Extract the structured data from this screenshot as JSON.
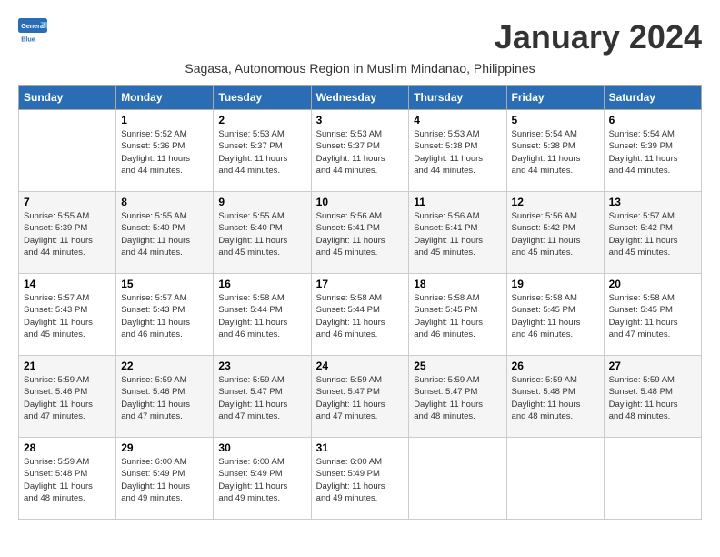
{
  "header": {
    "logo_general": "General",
    "logo_blue": "Blue",
    "month_title": "January 2024",
    "subtitle": "Sagasa, Autonomous Region in Muslim Mindanao, Philippines"
  },
  "days_of_week": [
    "Sunday",
    "Monday",
    "Tuesday",
    "Wednesday",
    "Thursday",
    "Friday",
    "Saturday"
  ],
  "weeks": [
    [
      {
        "day": "",
        "info": ""
      },
      {
        "day": "1",
        "info": "Sunrise: 5:52 AM\nSunset: 5:36 PM\nDaylight: 11 hours\nand 44 minutes."
      },
      {
        "day": "2",
        "info": "Sunrise: 5:53 AM\nSunset: 5:37 PM\nDaylight: 11 hours\nand 44 minutes."
      },
      {
        "day": "3",
        "info": "Sunrise: 5:53 AM\nSunset: 5:37 PM\nDaylight: 11 hours\nand 44 minutes."
      },
      {
        "day": "4",
        "info": "Sunrise: 5:53 AM\nSunset: 5:38 PM\nDaylight: 11 hours\nand 44 minutes."
      },
      {
        "day": "5",
        "info": "Sunrise: 5:54 AM\nSunset: 5:38 PM\nDaylight: 11 hours\nand 44 minutes."
      },
      {
        "day": "6",
        "info": "Sunrise: 5:54 AM\nSunset: 5:39 PM\nDaylight: 11 hours\nand 44 minutes."
      }
    ],
    [
      {
        "day": "7",
        "info": "Sunrise: 5:55 AM\nSunset: 5:39 PM\nDaylight: 11 hours\nand 44 minutes."
      },
      {
        "day": "8",
        "info": "Sunrise: 5:55 AM\nSunset: 5:40 PM\nDaylight: 11 hours\nand 44 minutes."
      },
      {
        "day": "9",
        "info": "Sunrise: 5:55 AM\nSunset: 5:40 PM\nDaylight: 11 hours\nand 45 minutes."
      },
      {
        "day": "10",
        "info": "Sunrise: 5:56 AM\nSunset: 5:41 PM\nDaylight: 11 hours\nand 45 minutes."
      },
      {
        "day": "11",
        "info": "Sunrise: 5:56 AM\nSunset: 5:41 PM\nDaylight: 11 hours\nand 45 minutes."
      },
      {
        "day": "12",
        "info": "Sunrise: 5:56 AM\nSunset: 5:42 PM\nDaylight: 11 hours\nand 45 minutes."
      },
      {
        "day": "13",
        "info": "Sunrise: 5:57 AM\nSunset: 5:42 PM\nDaylight: 11 hours\nand 45 minutes."
      }
    ],
    [
      {
        "day": "14",
        "info": "Sunrise: 5:57 AM\nSunset: 5:43 PM\nDaylight: 11 hours\nand 45 minutes."
      },
      {
        "day": "15",
        "info": "Sunrise: 5:57 AM\nSunset: 5:43 PM\nDaylight: 11 hours\nand 46 minutes."
      },
      {
        "day": "16",
        "info": "Sunrise: 5:58 AM\nSunset: 5:44 PM\nDaylight: 11 hours\nand 46 minutes."
      },
      {
        "day": "17",
        "info": "Sunrise: 5:58 AM\nSunset: 5:44 PM\nDaylight: 11 hours\nand 46 minutes."
      },
      {
        "day": "18",
        "info": "Sunrise: 5:58 AM\nSunset: 5:45 PM\nDaylight: 11 hours\nand 46 minutes."
      },
      {
        "day": "19",
        "info": "Sunrise: 5:58 AM\nSunset: 5:45 PM\nDaylight: 11 hours\nand 46 minutes."
      },
      {
        "day": "20",
        "info": "Sunrise: 5:58 AM\nSunset: 5:45 PM\nDaylight: 11 hours\nand 47 minutes."
      }
    ],
    [
      {
        "day": "21",
        "info": "Sunrise: 5:59 AM\nSunset: 5:46 PM\nDaylight: 11 hours\nand 47 minutes."
      },
      {
        "day": "22",
        "info": "Sunrise: 5:59 AM\nSunset: 5:46 PM\nDaylight: 11 hours\nand 47 minutes."
      },
      {
        "day": "23",
        "info": "Sunrise: 5:59 AM\nSunset: 5:47 PM\nDaylight: 11 hours\nand 47 minutes."
      },
      {
        "day": "24",
        "info": "Sunrise: 5:59 AM\nSunset: 5:47 PM\nDaylight: 11 hours\nand 47 minutes."
      },
      {
        "day": "25",
        "info": "Sunrise: 5:59 AM\nSunset: 5:47 PM\nDaylight: 11 hours\nand 48 minutes."
      },
      {
        "day": "26",
        "info": "Sunrise: 5:59 AM\nSunset: 5:48 PM\nDaylight: 11 hours\nand 48 minutes."
      },
      {
        "day": "27",
        "info": "Sunrise: 5:59 AM\nSunset: 5:48 PM\nDaylight: 11 hours\nand 48 minutes."
      }
    ],
    [
      {
        "day": "28",
        "info": "Sunrise: 5:59 AM\nSunset: 5:48 PM\nDaylight: 11 hours\nand 48 minutes."
      },
      {
        "day": "29",
        "info": "Sunrise: 6:00 AM\nSunset: 5:49 PM\nDaylight: 11 hours\nand 49 minutes."
      },
      {
        "day": "30",
        "info": "Sunrise: 6:00 AM\nSunset: 5:49 PM\nDaylight: 11 hours\nand 49 minutes."
      },
      {
        "day": "31",
        "info": "Sunrise: 6:00 AM\nSunset: 5:49 PM\nDaylight: 11 hours\nand 49 minutes."
      },
      {
        "day": "",
        "info": ""
      },
      {
        "day": "",
        "info": ""
      },
      {
        "day": "",
        "info": ""
      }
    ]
  ]
}
